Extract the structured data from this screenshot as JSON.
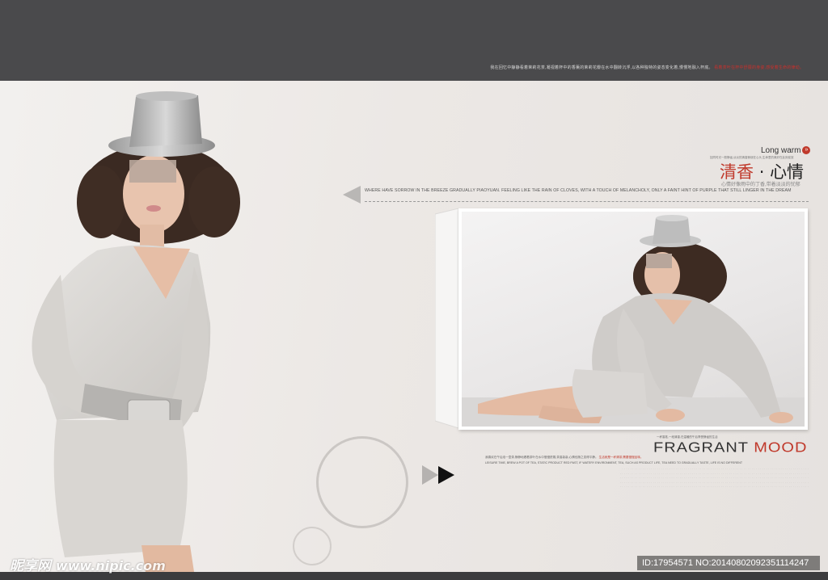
{
  "header": {
    "caption": "我在回忆中静静看着茉莉花茶,凝视着杯中的香薰的茉莉花瓣在水中翻转沉浮,以各种独特的姿态变化着,慢慢地融入杯底。",
    "caption_red": "看着茶叶在杯中舒展的身姿,感受着生命的律动。"
  },
  "intro": {
    "long_warm": "Long warm",
    "long_warm_icon": "double-chevron-right-icon",
    "tiny_text": "如同时光一般静谧,淡淡的清香萦绕在心头,生命里的美好在此刻绽放",
    "heading_main": "清香",
    "heading_dot": "·",
    "heading_second": "心情",
    "sub_heading": "心情好像雨中的丁香,带着淡淡的忧郁",
    "quote": "WHERE HAVE SORROW IN THE BREEZE GRADUALLY PIAOYUAN. FEELING LIKE THE RAIN OF CLOVES, WITH A TOUCH OF MELANCHOLY, ONLY A FAINT HINT OF PURPLE THAT STILL LINGER IN THE DREAM"
  },
  "fragrant": {
    "sub": "一杯香茗,一段清香,在温暖的午后享受静谧的生活",
    "title_a": "FRAGRANT",
    "title_b": "MOOD",
    "p1": "我喜欢在午后泡一壶茶,静静地看着茶叶在水中慢慢舒展,茶香袅袅,心情也随之变得平静。",
    "p1_red": "生活就是一杯清茶,需要慢慢品味。",
    "p2": "LEISURE TIME, BREW A POT OF TEA, STATIC PRODUCT RED PAST, IF WATERY ENVIRONMENT, TEA, SUCH AS PRODUCT LIFE, TEA NEED TO GRADUALLY TASTE, LIFE IS NO DIFFERENT",
    "filler": [
      "· · · · · · · · · · · · · · · · · · · · · · · · · · · · · · · · · · · · · · · · · · · · · · · · · · · · · · · · · · · · · · · · · · · · · · · · · · · · · · · · · · · · · · · · · · ·",
      "· · · · · · · · · · · · · · · · · · · · · · · · · · · · · · · · · · · · · · · · · · · · · · · · · · · · · · · · · · · · · · · · · · · · · · · · · · · · · · · · · · · · · · · · · · · ·",
      "· · · · · · · · · · · · · · · · · · · · · · · · · · · · · · · · · · · · · · · · · · · · · · · · · · · · · · · · · · · · · · · · · · · · · · · · · · · · · · · · · · · · · · · · · · · ·",
      "· · · · · · · · · · · · · · · · · · · · · · · · · · · · · · · · · · · · · · · · · · · · · · · · · · · · · · · · · · · · · · · · · · · · · · · · · · · · · · · · · · · · · · · · · · · ·",
      "· · · · · · · · · · · · · · · · · · · · · · · · · · · · · · · · · · · · · · · · · · · · · · · · · · · · · · · · · · · · · · · · · · · · · · · · · · · · · · · · · · · · · · · · · · · ·"
    ]
  },
  "watermark": {
    "site": "昵享网",
    "url": "www.nipic.com",
    "id_text": "ID:17954571 NO:20140802092351114247"
  },
  "colors": {
    "accent": "#c0392b",
    "header_band": "#4a4a4c",
    "background": "#ebe7e4"
  }
}
